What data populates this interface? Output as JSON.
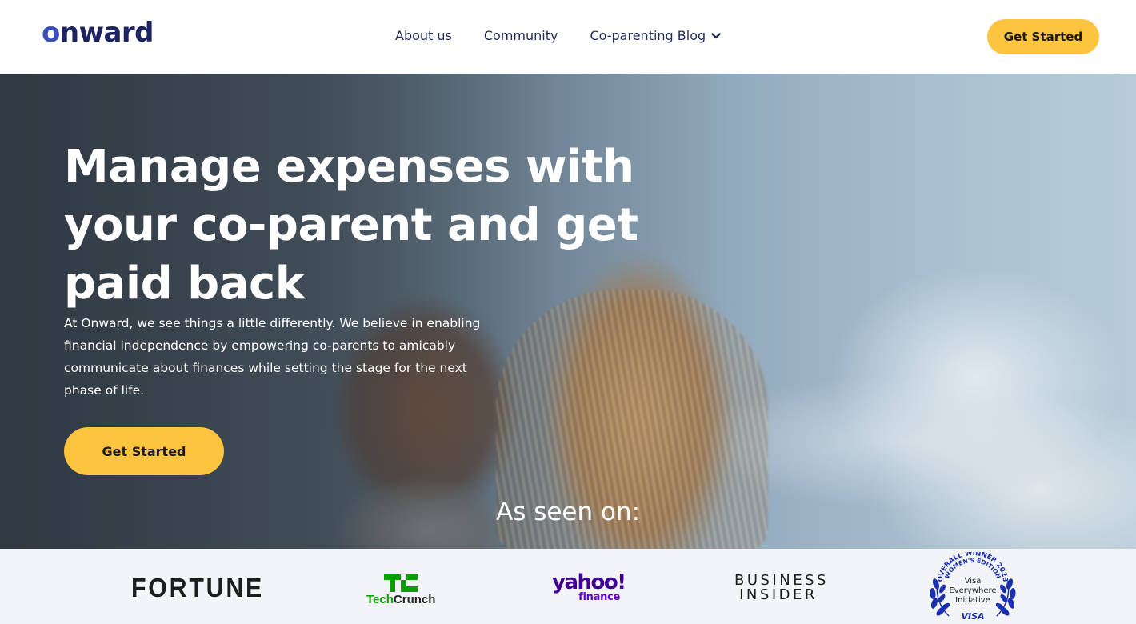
{
  "header": {
    "logo_text": "onward",
    "nav": [
      {
        "label": "About us"
      },
      {
        "label": "Community"
      },
      {
        "label": "Co-parenting Blog",
        "has_dropdown": true
      }
    ],
    "cta_label": "Get Started"
  },
  "hero": {
    "title": "Manage expenses with your co-parent and get paid back",
    "description": "At Onward, we see things a little differently. We believe in enabling financial independence by empowering co-parents to amicably communicate about finances while setting the stage for the next phase of life.",
    "cta_label": "Get Started",
    "as_seen_on": "As seen on:"
  },
  "press_logos": {
    "fortune": "FORTUNE",
    "techcrunch_mark": "TC",
    "techcrunch_tech": "Tech",
    "techcrunch_crunch": "Crunch",
    "yahoo_main": "yahoo!",
    "yahoo_sub": "finance",
    "business_insider_line1": "BUSINESS",
    "business_insider_line2": "INSIDER",
    "visa_arc": "OVERALL WINNER 2023",
    "visa_arc2": "WOMEN'S EDITION",
    "visa_line1": "Visa",
    "visa_line2": "Everywhere",
    "visa_line3": "Initiative",
    "visa_brand": "VISA"
  },
  "colors": {
    "accent_yellow": "#fdc43f",
    "brand_navy": "#1b2461",
    "techcrunch_green": "#0a9e01",
    "yahoo_purple": "#6001d2",
    "visa_blue": "#1a2fb0"
  }
}
